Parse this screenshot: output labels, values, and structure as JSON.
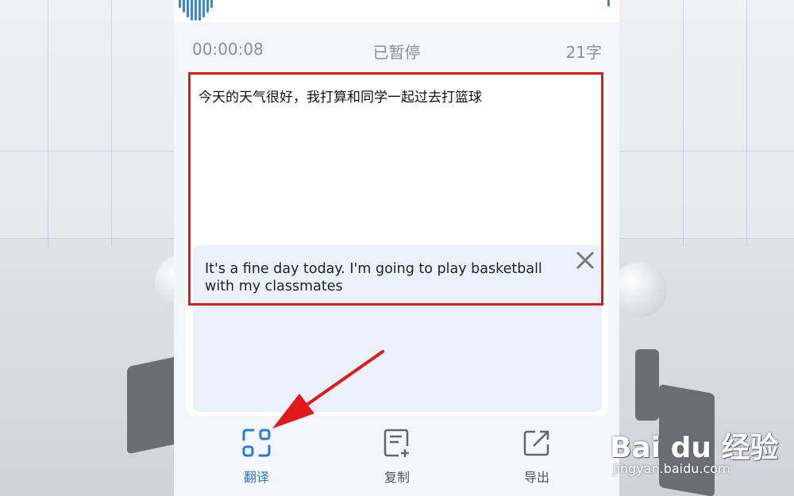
{
  "status": {
    "time": "00:00:08",
    "state": "已暂停",
    "word_count": "21字"
  },
  "transcript": {
    "text": "今天的天气很好，我打算和同学一起过去打篮球"
  },
  "translation": {
    "text": "It's a fine day today. I'm going to play basketball with my classmates",
    "close_icon": "close-icon"
  },
  "toolbar": {
    "translate_label": "翻译",
    "copy_label": "复制",
    "export_label": "导出",
    "translate_icon": "scan-translate-icon",
    "copy_icon": "copy-document-icon",
    "export_icon": "export-share-icon"
  },
  "annotation": {
    "highlight_color": "#e01a1a",
    "arrow_color": "#e01a1a"
  },
  "watermark": {
    "logo": "Bai du 经验",
    "url": "jingyan.baidu.com"
  },
  "colors": {
    "accent": "#2b7bd6",
    "wave": "#3a86d6"
  }
}
